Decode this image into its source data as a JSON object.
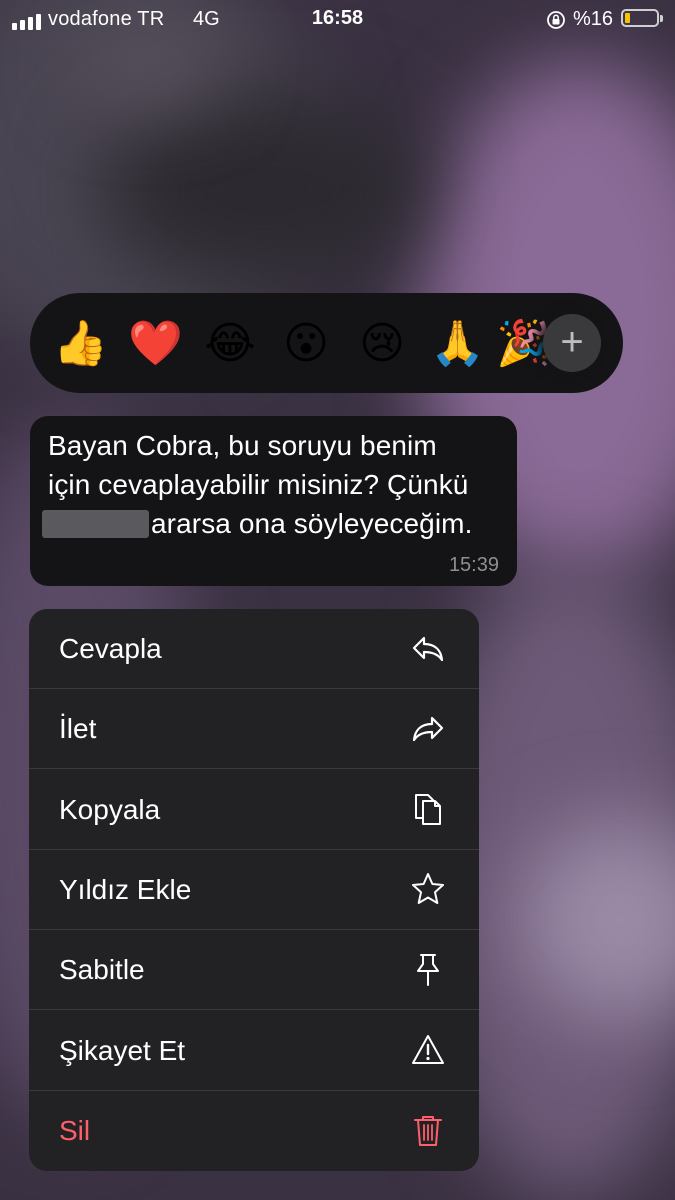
{
  "status_bar": {
    "carrier": "vodafone TR",
    "network": "4G",
    "time": "16:58",
    "battery_text": "%16",
    "battery_level": 0.16
  },
  "reactions": {
    "emojis": [
      "👍",
      "❤️",
      "😂",
      "😮",
      "😢",
      "🙏",
      "🎉"
    ],
    "more_label": "+"
  },
  "message": {
    "line1": "Bayan Cobra, bu soruyu benim",
    "line2": "için cevaplayabilir misiniz? Çünkü",
    "line3": "ararsa ona söyleyeceğim.",
    "time": "15:39"
  },
  "menu": {
    "items": [
      {
        "label": "Cevapla",
        "icon": "reply-icon"
      },
      {
        "label": "İlet",
        "icon": "forward-icon"
      },
      {
        "label": "Kopyala",
        "icon": "copy-icon"
      },
      {
        "label": "Yıldız Ekle",
        "icon": "star-icon"
      },
      {
        "label": "Sabitle",
        "icon": "pin-icon"
      },
      {
        "label": "Şikayet Et",
        "icon": "warning-icon"
      },
      {
        "label": "Sil",
        "icon": "trash-icon"
      }
    ]
  },
  "colors": {
    "danger": "#ff5f6b",
    "menu_bg": "#222224",
    "bubble_bg": "#141416"
  }
}
